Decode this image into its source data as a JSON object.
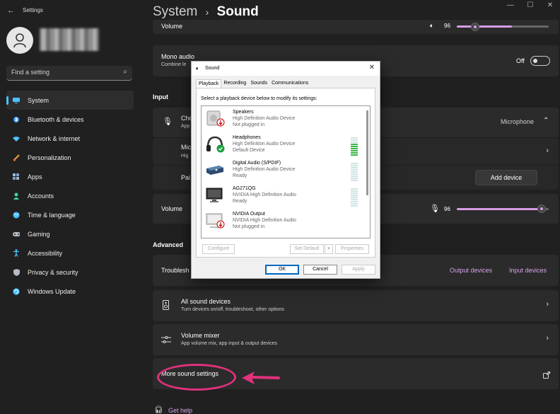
{
  "window": {
    "title": "Settings",
    "controls": [
      "—",
      "☐",
      "✕"
    ]
  },
  "sidebar": {
    "search_placeholder": "Find a setting",
    "items": [
      {
        "label": "System",
        "icon": "system-icon",
        "color": "#4cc2ff"
      },
      {
        "label": "Bluetooth & devices",
        "icon": "bluetooth-icon",
        "color": "#3b9cff"
      },
      {
        "label": "Network & internet",
        "icon": "wifi-icon",
        "color": "#4cc2ff"
      },
      {
        "label": "Personalization",
        "icon": "brush-icon",
        "color": "#f0a040"
      },
      {
        "label": "Apps",
        "icon": "apps-icon",
        "color": "#9fb7d6"
      },
      {
        "label": "Accounts",
        "icon": "person-icon",
        "color": "#3fd7a3"
      },
      {
        "label": "Time & language",
        "icon": "globe-icon",
        "color": "#4cc2ff"
      },
      {
        "label": "Gaming",
        "icon": "gamepad-icon",
        "color": "#b4bcc6"
      },
      {
        "label": "Accessibility",
        "icon": "accessibility-icon",
        "color": "#4cc2ff"
      },
      {
        "label": "Privacy & security",
        "icon": "shield-icon",
        "color": "#b4bcc6"
      },
      {
        "label": "Windows Update",
        "icon": "update-icon",
        "color": "#4cc2ff"
      }
    ]
  },
  "header": {
    "crumb": "System",
    "sep": "›",
    "title": "Sound"
  },
  "main": {
    "top_volume_label": "Volume",
    "top_volume_value": "96",
    "mono_audio": {
      "title": "Mono audio",
      "subtitle": "Combine le",
      "state": "Off"
    },
    "input_section": "Input",
    "choose_device": {
      "title": "Cho",
      "subtitle": "App",
      "value": "Microphone"
    },
    "mic_row": {
      "title": "Mic",
      "subtitle": "Hig"
    },
    "pair_row": {
      "title": "Pai",
      "button": "Add device"
    },
    "input_volume": {
      "label": "Volume",
      "value": "96",
      "level": 0.96
    },
    "advanced_section": "Advanced",
    "troubleshoot": {
      "title": "Troublesh",
      "output": "Output devices",
      "input": "Input devices"
    },
    "all_devices": {
      "title": "All sound devices",
      "subtitle": "Turn devices on/off, troubleshoot, other options"
    },
    "mixer": {
      "title": "Volume mixer",
      "subtitle": "App volume mix, app input & output devices"
    },
    "more_settings": "More sound settings",
    "get_help": "Get help"
  },
  "dialog": {
    "title": "Sound",
    "tabs": [
      "Playback",
      "Recording",
      "Sounds",
      "Communications"
    ],
    "instruction": "Select a playback device below to modify its settings:",
    "devices": [
      {
        "name": "Speakers",
        "line1": "High Definition Audio Device",
        "line2": "Not plugged in",
        "icon": "speaker-icon",
        "status": "unplugged"
      },
      {
        "name": "Headphones",
        "line1": "High Definition Audio Device",
        "line2": "Default Device",
        "icon": "headphones-icon",
        "status": "default"
      },
      {
        "name": "Digital Audio (S/PDIF)",
        "line1": "High Definition Audio Device",
        "line2": "Ready",
        "icon": "spdif-icon",
        "status": "ready"
      },
      {
        "name": "AG271QG",
        "line1": "NVIDIA High Definition Audio",
        "line2": "Ready",
        "icon": "monitor-icon",
        "status": "ready"
      },
      {
        "name": "NVIDIA Output",
        "line1": "NVIDIA High Definition Audio",
        "line2": "Not plugged in",
        "icon": "monitor-icon",
        "status": "unplugged"
      }
    ],
    "buttons": {
      "configure": "Configure",
      "set_default": "Set Default",
      "properties": "Properties",
      "ok": "OK",
      "cancel": "Cancel",
      "apply": "Apply"
    }
  },
  "colors": {
    "accent": "#d79ce6",
    "annotation": "#e0317b"
  }
}
